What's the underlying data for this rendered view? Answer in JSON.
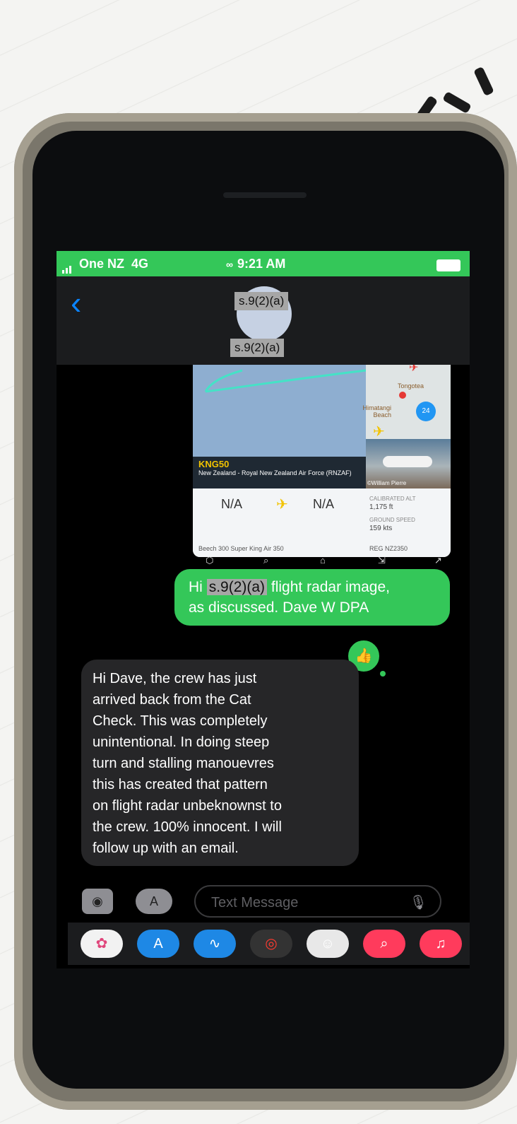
{
  "status_bar": {
    "carrier": "One NZ",
    "network": "4G",
    "time": "9:21 AM"
  },
  "contact": {
    "avatar_redaction": "s.9(2)(a)",
    "name_redaction": "s.9(2)(a)"
  },
  "flight_card": {
    "map_place_1": "Tongotea",
    "map_place_2": "Himatangi Beach",
    "flight_id": "KNG50",
    "operator": "New Zealand - Royal New Zealand Air Force (RNZAF)",
    "photo_credit": "©William Pierre",
    "origin": "N/A",
    "destination": "N/A",
    "calibrated_alt_label": "CALIBRATED ALT",
    "calibrated_alt_value": "1,175 ft",
    "ground_speed_label": "GROUND SPEED",
    "ground_speed_value": "159 kts",
    "aircraft_model": "Beech 300 Super King Air 350",
    "registration": "REG NZ2350"
  },
  "messages": {
    "outgoing": {
      "prefix": "Hi",
      "redaction": "s.9(2)(a)",
      "suffix": "flight radar image,",
      "line2": "as discussed. Dave W DPA"
    },
    "incoming_lines": [
      "Hi Dave, the crew has just",
      "arrived back from the Cat",
      "Check. This was completely",
      "unintentional. In doing steep",
      "turn and stalling manouevres",
      "this has created that pattern",
      "on flight radar unbeknownst to",
      "the crew. 100% innocent. I will",
      "follow up with an email."
    ]
  },
  "composer": {
    "placeholder": "Text Message"
  },
  "colors": {
    "imessage_green": "#34c759",
    "ios_blue": "#0a84ff",
    "incoming_bubble": "#262628"
  },
  "icons": {
    "status": [
      "signal-icon",
      "link-icon",
      "battery-icon"
    ],
    "nav": [
      "back-chevron-icon"
    ],
    "composer": [
      "camera-icon",
      "app-store-icon",
      "microphone-icon"
    ],
    "app_strip": [
      "photos-icon",
      "app-store-icon",
      "audio-message-icon",
      "activity-icon",
      "memoji-icon",
      "search-images-icon",
      "music-icon"
    ]
  }
}
